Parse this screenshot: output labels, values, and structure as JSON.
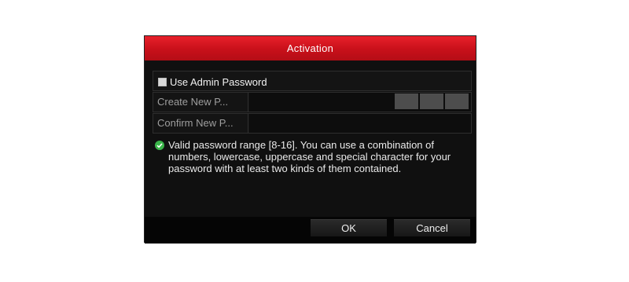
{
  "dialog": {
    "title": "Activation",
    "use_admin_password_label": "Use Admin Password",
    "use_admin_password_checked": false,
    "create_password_label": "Create New P...",
    "confirm_password_label": "Confirm New P...",
    "create_password_value": "",
    "confirm_password_value": "",
    "hint_icon": "check-circle-icon",
    "hint_text": "Valid password range [8-16]. You can use a combination of numbers, lowercase, uppercase and special character for your password with at least two kinds of them contained.",
    "ok_label": "OK",
    "cancel_label": "Cancel"
  },
  "colors": {
    "title_bar": "#d0121c",
    "background": "#101010",
    "hint_icon": "#3bb54a"
  }
}
